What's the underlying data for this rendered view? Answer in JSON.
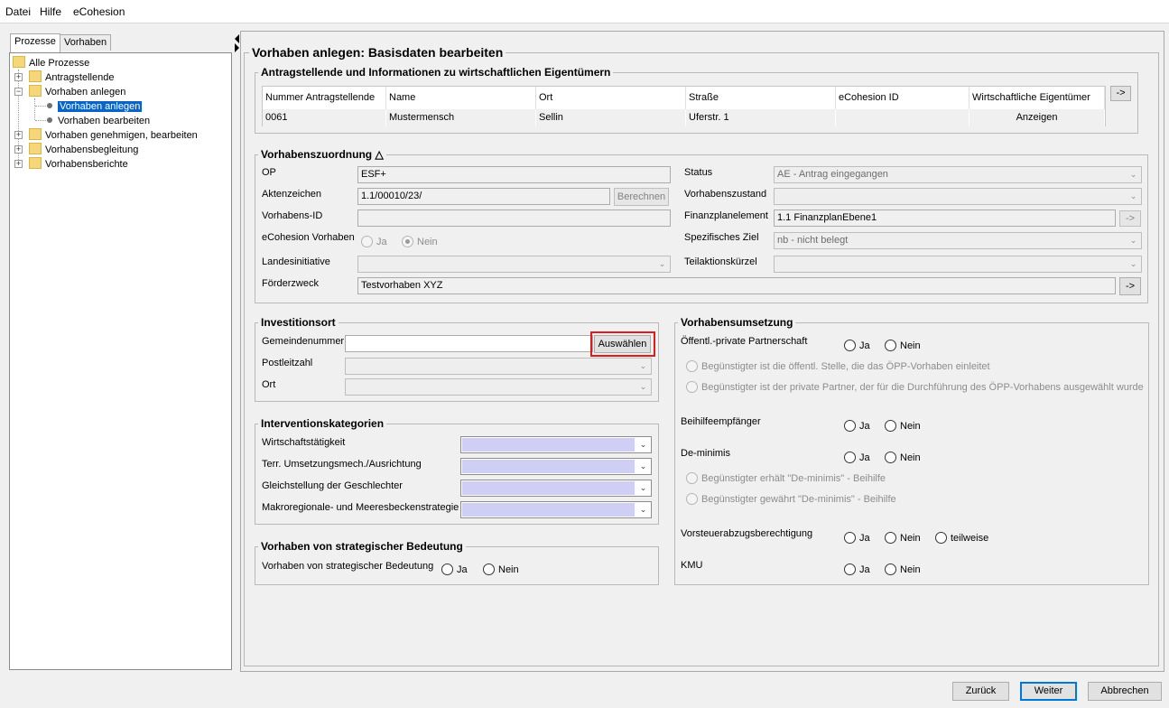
{
  "menu": {
    "file": "Datei",
    "help": "Hilfe",
    "ecohesion": "eCohesion"
  },
  "left_tabs": {
    "processes": "Prozesse",
    "projects": "Vorhaben"
  },
  "tree": {
    "root": "Alle Prozesse",
    "items": [
      "Antragstellende",
      "Vorhaben anlegen",
      "Vorhaben anlegen",
      "Vorhaben bearbeiten",
      "Vorhaben genehmigen, bearbeiten",
      "Vorhabensbegleitung",
      "Vorhabensberichte"
    ]
  },
  "main": {
    "title": "Vorhaben anlegen: Basisdaten bearbeiten",
    "applicants": {
      "legend": "Antragstellende und Informationen zu wirtschaftlichen Eigentümern",
      "columns": [
        "Nummer Antragstellende",
        "Name",
        "Ort",
        "Straße",
        "eCohesion ID",
        "Wirtschaftliche Eigentümer"
      ],
      "row": [
        "0061",
        "Mustermensch",
        "Sellin",
        "Uferstr. 1",
        "",
        "Anzeigen"
      ],
      "arrow_button": "->"
    },
    "assignment": {
      "legend": "Vorhabenszuordnung",
      "legend_icon": "△",
      "op_label": "OP",
      "op_value": "ESF+",
      "file_no_label": "Aktenzeichen",
      "file_no_value": "1.1/00010/23/",
      "calc_button": "Berechnen",
      "project_id_label": "Vorhabens-ID",
      "project_id_value": "",
      "ecohesion_label": "eCohesion Vorhaben",
      "yes": "Ja",
      "no": "Nein",
      "initiative_label": "Landesinitiative",
      "purpose_label": "Förderzweck",
      "purpose_value": "Testvorhaben XYZ",
      "status_label": "Status",
      "status_value": "AE - Antrag eingegangen",
      "state_label": "Vorhabenszustand",
      "state_value": "",
      "finplan_label": "Finanzplanelement",
      "finplan_value": "1.1 FinanzplanEbene1",
      "goal_label": "Spezifisches Ziel",
      "goal_value": "nb - nicht belegt",
      "action_label": "Teilaktionskürzel",
      "action_value": "",
      "arrow": "->"
    },
    "investment": {
      "legend": "Investitionsort",
      "municipality_label": "Gemeindenummer",
      "municipality_value": "",
      "select_button": "Auswählen",
      "zip_label": "Postleitzahl",
      "city_label": "Ort"
    },
    "intervention": {
      "legend": "Interventionskategorien",
      "labels": [
        "Wirtschaftstätigkeit",
        "Terr. Umsetzungsmech./Ausrichtung",
        "Gleichstellung der Geschlechter",
        "Makroregionale- und Meeresbeckenstrategie"
      ]
    },
    "strategic": {
      "legend": "Vorhaben von strategischer Bedeutung",
      "label": "Vorhaben von strategischer Bedeutung",
      "yes": "Ja",
      "no": "Nein"
    },
    "implementation": {
      "legend": "Vorhabensumsetzung",
      "ppp_label": "Öffentl.-private Partnerschaft",
      "ppp_opt1": "Begünstigter ist die öffentl. Stelle, die das ÖPP-Vorhaben einleitet",
      "ppp_opt2": "Begünstigter ist der private Partner, der für die Durchführung des ÖPP-Vorhabens ausgewählt wurde",
      "aid_label": "Beihilfeempfänger",
      "deminimis_label": "De-minimis",
      "deminimis_opt1": "Begünstigter erhält \"De-minimis\" - Beihilfe",
      "deminimis_opt2": "Begünstigter gewährt \"De-minimis\" - Beihilfe",
      "tax_label": "Vorsteuerabzugsberechtigung",
      "partial": "teilweise",
      "kmu_label": "KMU",
      "yes": "Ja",
      "no": "Nein"
    }
  },
  "footer": {
    "back": "Zurück",
    "next": "Weiter",
    "cancel": "Abbrechen"
  }
}
